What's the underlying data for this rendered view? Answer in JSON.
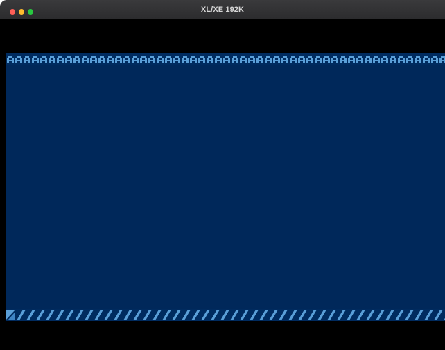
{
  "window": {
    "title": "XL/XE 192K"
  },
  "screen": {
    "top_glyph": "A",
    "bottom_glyph": "/",
    "colors": {
      "background": "#00285a",
      "glyph": "#5a9fd8",
      "glyph_dark": "#3f84c4"
    }
  }
}
